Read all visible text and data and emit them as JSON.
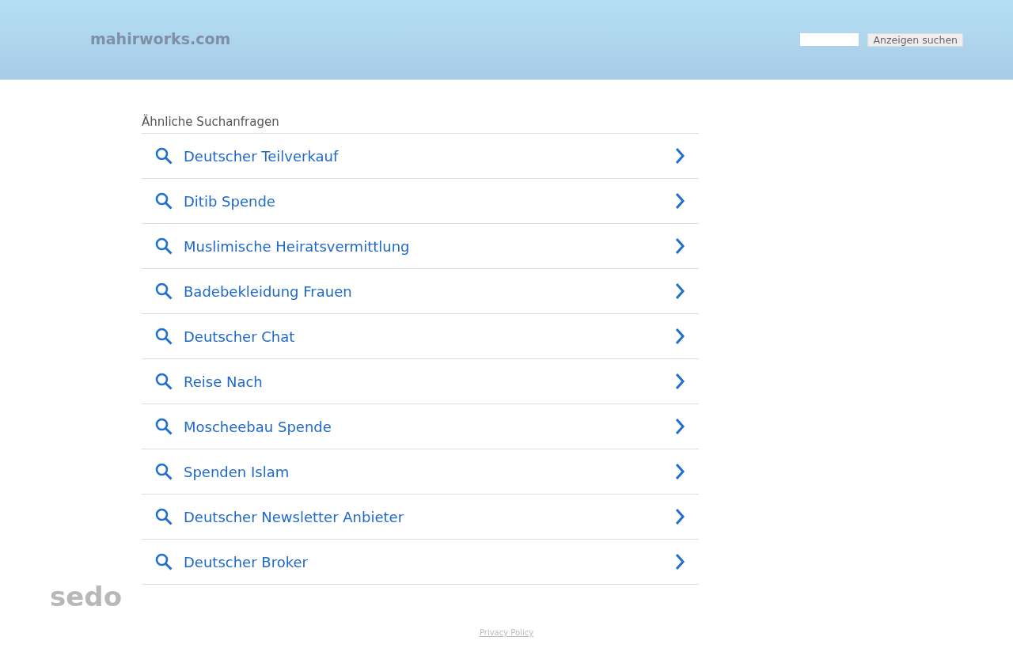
{
  "header": {
    "domain": "mahirworks.com",
    "search_button": "Anzeigen suchen"
  },
  "related": {
    "title": "Ähnliche Suchanfragen",
    "items": [
      {
        "label": "Deutscher Teilverkauf"
      },
      {
        "label": "Ditib Spende"
      },
      {
        "label": "Muslimische Heiratsvermittlung"
      },
      {
        "label": "Badebekleidung Frauen"
      },
      {
        "label": "Deutscher Chat"
      },
      {
        "label": "Reise Nach"
      },
      {
        "label": "Moscheebau Spende"
      },
      {
        "label": "Spenden Islam"
      },
      {
        "label": "Deutscher Newsletter Anbieter"
      },
      {
        "label": "Deutscher Broker"
      }
    ]
  },
  "logo": "sedo",
  "footer": {
    "privacy_link": "Privacy Policy"
  }
}
